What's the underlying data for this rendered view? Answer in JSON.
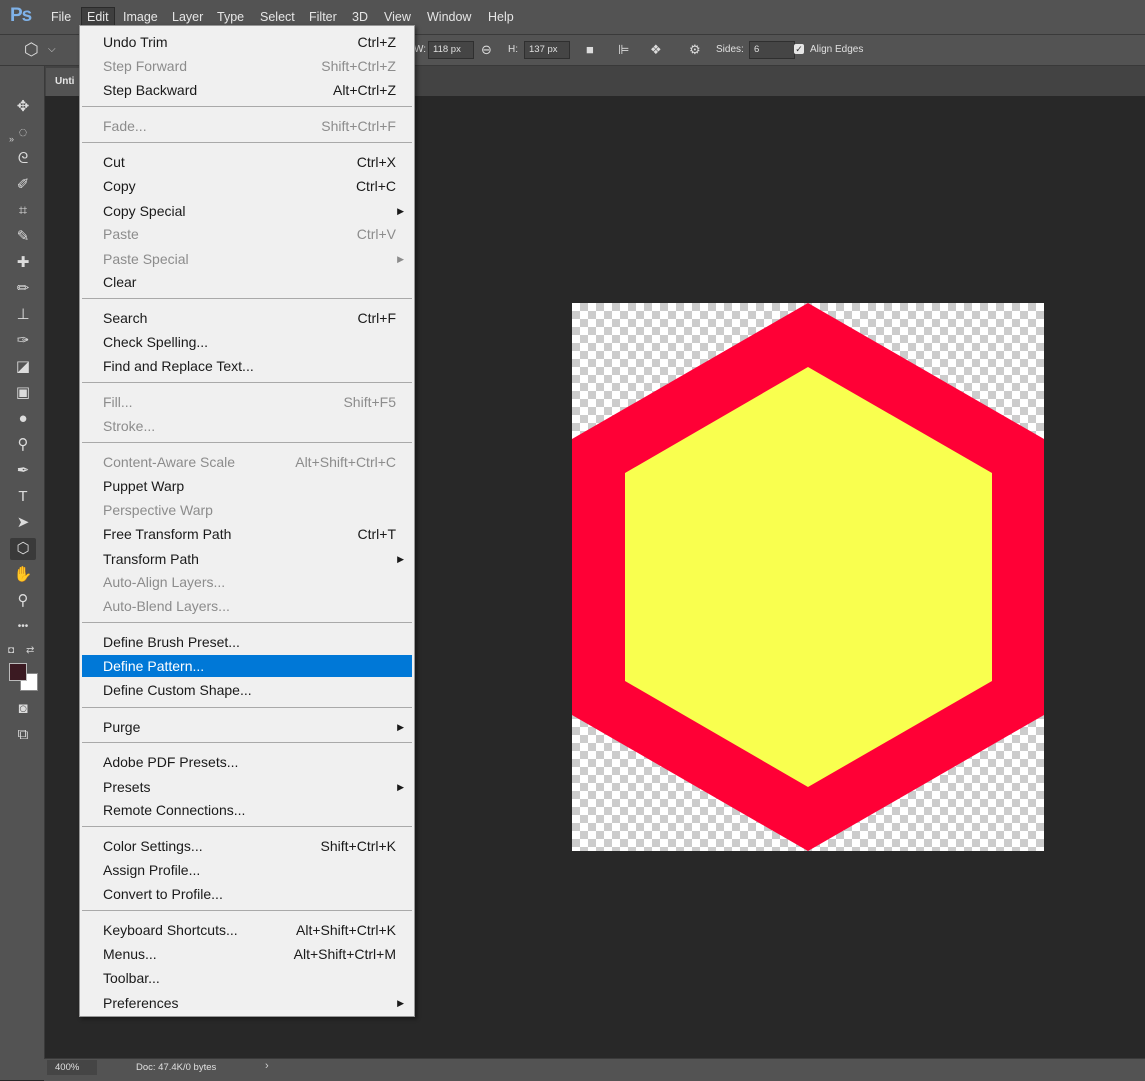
{
  "app": {
    "logo": "Ps"
  },
  "menubar": {
    "items": [
      "File",
      "Edit",
      "Image",
      "Layer",
      "Type",
      "Select",
      "Filter",
      "3D",
      "View",
      "Window",
      "Help"
    ],
    "active": "Edit"
  },
  "options": {
    "w_label": "W:",
    "w_value": "118 px",
    "h_label": "H:",
    "h_value": "137 px",
    "sides_label": "Sides:",
    "sides_value": "6",
    "align_edges_label": "Align Edges",
    "align_edges_checked": true
  },
  "document": {
    "tab_title": "Unti"
  },
  "status": {
    "zoom": "400%",
    "doc_info": "Doc: 47.4K/0 bytes"
  },
  "colors": {
    "hexagon_outer": "#ff0036",
    "hexagon_inner": "#f9ff4f",
    "foreground": "#3b1a22",
    "background": "#ffffff",
    "menu_highlight": "#0078d7"
  },
  "edit_menu": {
    "items": [
      {
        "label": "Undo Trim",
        "shortcut": "Ctrl+Z"
      },
      {
        "label": "Step Forward",
        "shortcut": "Shift+Ctrl+Z",
        "disabled": true
      },
      {
        "label": "Step Backward",
        "shortcut": "Alt+Ctrl+Z"
      },
      {
        "label": "Fade...",
        "shortcut": "Shift+Ctrl+F",
        "disabled": true
      },
      {
        "label": "Cut",
        "shortcut": "Ctrl+X"
      },
      {
        "label": "Copy",
        "shortcut": "Ctrl+C"
      },
      {
        "label": "Copy Special",
        "shortcut": ""
      },
      {
        "label": "Paste",
        "shortcut": "Ctrl+V",
        "disabled": true
      },
      {
        "label": "Paste Special",
        "shortcut": "",
        "disabled": true
      },
      {
        "label": "Clear",
        "shortcut": ""
      },
      {
        "label": "Search",
        "shortcut": "Ctrl+F"
      },
      {
        "label": "Check Spelling...",
        "shortcut": ""
      },
      {
        "label": "Find and Replace Text...",
        "shortcut": ""
      },
      {
        "label": "Fill...",
        "shortcut": "Shift+F5",
        "disabled": true
      },
      {
        "label": "Stroke...",
        "shortcut": "",
        "disabled": true
      },
      {
        "label": "Content-Aware Scale",
        "shortcut": "Alt+Shift+Ctrl+C",
        "disabled": true
      },
      {
        "label": "Puppet Warp",
        "shortcut": ""
      },
      {
        "label": "Perspective Warp",
        "shortcut": "",
        "disabled": true
      },
      {
        "label": "Free Transform Path",
        "shortcut": "Ctrl+T"
      },
      {
        "label": "Transform Path",
        "shortcut": ""
      },
      {
        "label": "Auto-Align Layers...",
        "shortcut": "",
        "disabled": true
      },
      {
        "label": "Auto-Blend Layers...",
        "shortcut": "",
        "disabled": true
      },
      {
        "label": "Define Brush Preset...",
        "shortcut": ""
      },
      {
        "label": "Define Pattern...",
        "shortcut": "",
        "highlighted": true
      },
      {
        "label": "Define Custom Shape...",
        "shortcut": ""
      },
      {
        "label": "Purge",
        "shortcut": ""
      },
      {
        "label": "Adobe PDF Presets...",
        "shortcut": ""
      },
      {
        "label": "Presets",
        "shortcut": ""
      },
      {
        "label": "Remote Connections...",
        "shortcut": ""
      },
      {
        "label": "Color Settings...",
        "shortcut": "Shift+Ctrl+K"
      },
      {
        "label": "Assign Profile...",
        "shortcut": ""
      },
      {
        "label": "Convert to Profile...",
        "shortcut": ""
      },
      {
        "label": "Keyboard Shortcuts...",
        "shortcut": "Alt+Shift+Ctrl+K"
      },
      {
        "label": "Menus...",
        "shortcut": "Alt+Shift+Ctrl+M"
      },
      {
        "label": "Toolbar...",
        "shortcut": ""
      },
      {
        "label": "Preferences",
        "shortcut": ""
      }
    ]
  },
  "tools": {
    "items": [
      {
        "name": "move-tool-icon",
        "glyph": "✥"
      },
      {
        "name": "marquee-tool-icon",
        "glyph": "◌"
      },
      {
        "name": "lasso-tool-icon",
        "glyph": "ᘓ"
      },
      {
        "name": "quick-selection-tool-icon",
        "glyph": "✐"
      },
      {
        "name": "crop-tool-icon",
        "glyph": "⌗"
      },
      {
        "name": "eyedropper-tool-icon",
        "glyph": "✎"
      },
      {
        "name": "healing-brush-tool-icon",
        "glyph": "✚"
      },
      {
        "name": "brush-tool-icon",
        "glyph": "✏"
      },
      {
        "name": "clone-stamp-tool-icon",
        "glyph": "⊥"
      },
      {
        "name": "history-brush-tool-icon",
        "glyph": "✑"
      },
      {
        "name": "eraser-tool-icon",
        "glyph": "◪"
      },
      {
        "name": "gradient-tool-icon",
        "glyph": "▣"
      },
      {
        "name": "blur-tool-icon",
        "glyph": "●"
      },
      {
        "name": "dodge-tool-icon",
        "glyph": "⚲"
      },
      {
        "name": "pen-tool-icon",
        "glyph": "✒"
      },
      {
        "name": "type-tool-icon",
        "glyph": "T"
      },
      {
        "name": "path-selection-tool-icon",
        "glyph": "➤"
      },
      {
        "name": "polygon-tool-icon",
        "glyph": "⬡"
      },
      {
        "name": "hand-tool-icon",
        "glyph": "✋"
      },
      {
        "name": "zoom-tool-icon",
        "glyph": "⚲"
      },
      {
        "name": "more-tools-icon",
        "glyph": "•••"
      }
    ],
    "selected": "polygon-tool-icon"
  }
}
